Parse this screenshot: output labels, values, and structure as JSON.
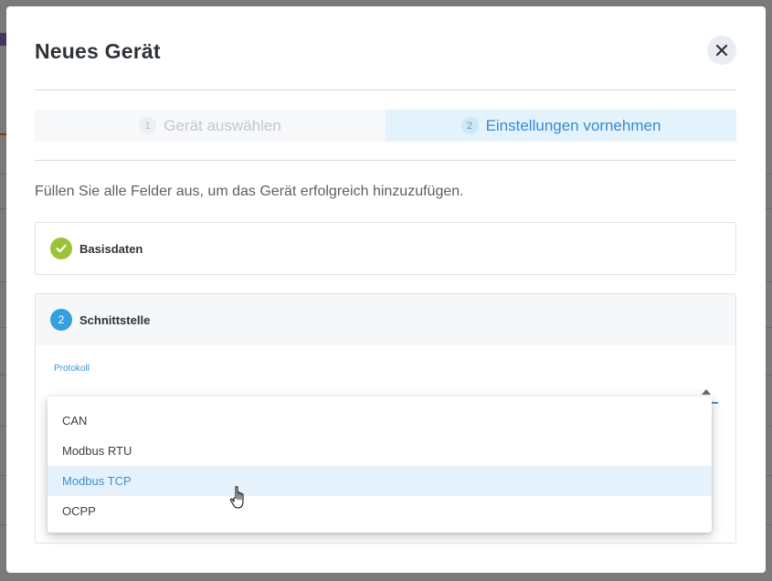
{
  "modal": {
    "title": "Neues Gerät",
    "close_icon": "close-icon"
  },
  "steps": [
    {
      "number": "1",
      "label": "Gerät auswählen",
      "active": false
    },
    {
      "number": "2",
      "label": "Einstellungen vornehmen",
      "active": true
    }
  ],
  "intro": "Füllen Sie alle Felder aus, um das Gerät erfolgreich hinzuzufügen.",
  "sections": {
    "basisdaten": {
      "label": "Basisdaten",
      "status_icon": "check-icon"
    },
    "schnittstelle": {
      "number": "2",
      "label": "Schnittstelle"
    }
  },
  "protocol": {
    "label": "Protokoll",
    "value": "",
    "options": [
      "CAN",
      "Modbus RTU",
      "Modbus TCP",
      "OCPP"
    ],
    "hovered": "Modbus TCP"
  },
  "colors": {
    "accent": "#3f95d3",
    "success": "#9cc23a",
    "step_active_bg": "#e3f2fb"
  }
}
